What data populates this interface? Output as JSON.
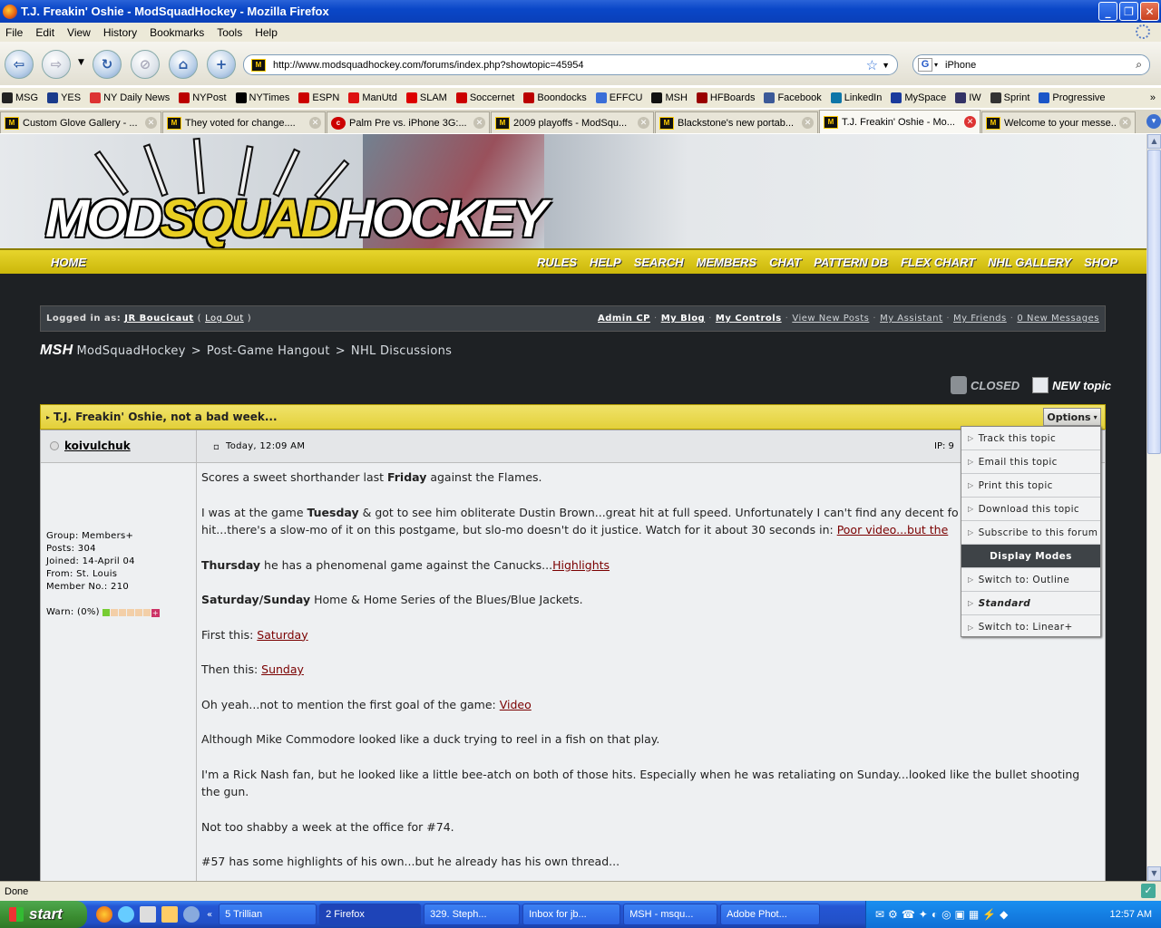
{
  "window": {
    "title": "T.J. Freakin' Oshie - ModSquadHockey - Mozilla Firefox"
  },
  "menu": [
    "File",
    "Edit",
    "View",
    "History",
    "Bookmarks",
    "Tools",
    "Help"
  ],
  "url": "http://www.modsquadhockey.com/forums/index.php?showtopic=45954",
  "search": {
    "engine_icon": "google-icon",
    "value": "iPhone"
  },
  "bookmarks": [
    {
      "label": "MSG",
      "color": "#222"
    },
    {
      "label": "YES",
      "color": "#1a3b8c"
    },
    {
      "label": "NY Daily News",
      "color": "#d33"
    },
    {
      "label": "NYPost",
      "color": "#b00"
    },
    {
      "label": "NYTimes",
      "color": "#000"
    },
    {
      "label": "ESPN",
      "color": "#c00"
    },
    {
      "label": "ManUtd",
      "color": "#d11"
    },
    {
      "label": "SLAM",
      "color": "#d00"
    },
    {
      "label": "Soccernet",
      "color": "#c00"
    },
    {
      "label": "Boondocks",
      "color": "#b00"
    },
    {
      "label": "EFFCU",
      "color": "#3a6ed8"
    },
    {
      "label": "MSH",
      "color": "#111"
    },
    {
      "label": "HFBoards",
      "color": "#900"
    },
    {
      "label": "Facebook",
      "color": "#3b5998"
    },
    {
      "label": "LinkedIn",
      "color": "#0e76a8"
    },
    {
      "label": "MySpace",
      "color": "#1a3a9c"
    },
    {
      "label": "IW",
      "color": "#336"
    },
    {
      "label": "Sprint",
      "color": "#333"
    },
    {
      "label": "Progressive",
      "color": "#1b56c8"
    }
  ],
  "tabs": [
    {
      "label": "Custom Glove Gallery - ...",
      "active": false
    },
    {
      "label": "They voted for change....",
      "active": false
    },
    {
      "label": "Palm Pre vs. iPhone 3G:...",
      "active": false
    },
    {
      "label": "2009 playoffs - ModSqu...",
      "active": false
    },
    {
      "label": "Blackstone's new portab...",
      "active": false
    },
    {
      "label": "T.J. Freakin' Oshie - Mo...",
      "active": true
    },
    {
      "label": "Welcome to your messe...",
      "active": false
    }
  ],
  "site": {
    "logo_part1": "MOD",
    "logo_part2": "SQUAD",
    "logo_part3": "HOCKEY",
    "nav_home": "HOME",
    "nav": [
      "RULES",
      "HELP",
      "SEARCH",
      "MEMBERS",
      "CHAT",
      "PATTERN DB",
      "FLEX CHART",
      "NHL GALLERY",
      "SHOP"
    ],
    "login_prefix": "Logged in as:",
    "user": "JR Boucicaut",
    "logout": "Log Out",
    "user_links": [
      "Admin CP",
      "My Blog",
      "My Controls",
      "View New Posts",
      "My Assistant",
      "My Friends",
      "0 New Messages"
    ],
    "breadcrumb": [
      "ModSquadHockey",
      "Post-Game Hangout",
      "NHL Discussions"
    ],
    "closed_label": "CLOSED",
    "new_topic_label": "NEW topic"
  },
  "topic": {
    "title": "T.J. Freakin' Oshie, not a bad week...",
    "options_label": "Options",
    "author": "koivulchuk",
    "timestamp": "Today, 12:09 AM",
    "ip_label": "IP: 9",
    "author_info": {
      "group": "Group: Members+",
      "posts": "Posts: 304",
      "joined": "Joined: 14-April 04",
      "from": "From: St. Louis",
      "member_no": "Member No.: 210",
      "warn": "Warn: (0%)"
    }
  },
  "post": {
    "p1a": "Scores a sweet shorthander last ",
    "p1b": "Friday",
    "p1c": " against the Flames.",
    "p2a": "I was at the game ",
    "p2b": "Tuesday",
    "p2c": " & got to see him obliterate Dustin Brown...great hit at full speed. Unfortunately I can't find any decent fo",
    "p2d": "hit...there's a slow-mo of it on this postgame, but slo-mo doesn't do it justice. Watch for it about 30 seconds in: ",
    "p2link": "Poor video...but the",
    "p3a": "Thursday",
    "p3b": " he has a phenomenal game against the Canucks...",
    "p3link": "Highlights",
    "p4a": "Saturday/Sunday",
    "p4b": " Home & Home Series of the Blues/Blue Jackets.",
    "p5a": "First this: ",
    "p5link": "Saturday",
    "p6a": "Then this: ",
    "p6link": "Sunday",
    "p7a": "Oh yeah...not to mention the first goal of the game: ",
    "p7link": "Video",
    "p8": "Although Mike Commodore looked like a duck trying to reel in a fish on that play.",
    "p9": "I'm a Rick Nash fan, but he looked like a little bee-atch on both of those hits. Especially when he was retaliating on Sunday...looked like the bullet shooting the gun.",
    "p10": "Not too shabby a week at the office for #74.",
    "p11": "#57 has some highlights of his own...but he already has his own thread..."
  },
  "options_menu": {
    "items": [
      "Track this topic",
      "Email this topic",
      "Print this topic",
      "Download this topic",
      "Subscribe to this forum"
    ],
    "display_header": "Display Modes",
    "modes": [
      "Switch to: Outline",
      "Standard",
      "Switch to: Linear+"
    ]
  },
  "status": "Done",
  "taskbar": {
    "start": "start",
    "buttons": [
      "5 Trillian",
      "2 Firefox",
      "329. Steph...",
      "Inbox for jb...",
      "MSH - msqu...",
      "Adobe Phot..."
    ],
    "clock": "12:57 AM"
  }
}
